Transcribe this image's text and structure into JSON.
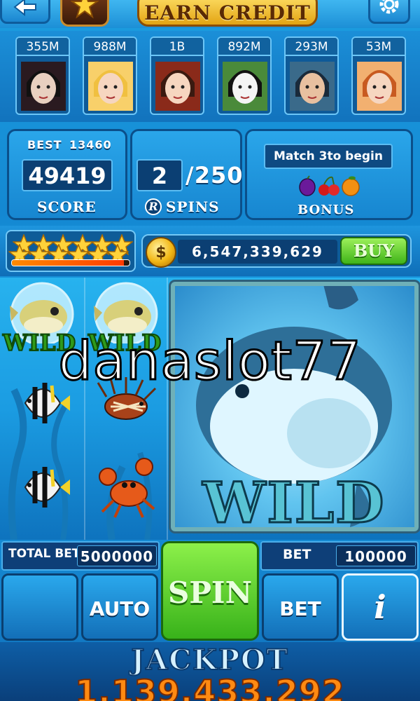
{
  "header": {
    "earn_credit_label": "EARN CREDIT",
    "back_icon": "back-arrow-icon",
    "rank_icon": "star-badge-icon",
    "settings_icon": "gear-icon"
  },
  "players": [
    {
      "amount": "355M",
      "avatar": "vampire-avatar",
      "color": "#7a2a2a"
    },
    {
      "amount": "988M",
      "avatar": "blonde-woman-avatar",
      "color": "#e8b84a"
    },
    {
      "amount": "1B",
      "avatar": "princess-avatar",
      "color": "#c0402a"
    },
    {
      "amount": "892M",
      "avatar": "panda-avatar",
      "color": "#e0e0e0"
    },
    {
      "amount": "293M",
      "avatar": "cap-boy-avatar",
      "color": "#2a4a6a"
    },
    {
      "amount": "53M",
      "avatar": "redhead-woman-avatar",
      "color": "#d86a3a"
    }
  ],
  "score_panel": {
    "best_label": "BEST",
    "best_value": "13460",
    "score_value": "49419",
    "score_label": "SCORE"
  },
  "spins_panel": {
    "current": "2",
    "total": "/250",
    "label": "SPINS",
    "logo_letter": "R"
  },
  "bonus_panel": {
    "match_text": "Match 3to begin",
    "label": "BONUS",
    "fruits": [
      "plum-icon",
      "cherry-icon",
      "orange-icon"
    ]
  },
  "level": {
    "stars": 6,
    "xp_fraction": 0.95
  },
  "credits": {
    "coin_symbol": "$",
    "value": "6,547,339,629",
    "buy_label": "BUY"
  },
  "reels": {
    "small_wild_label": "WILD",
    "big_wild_label": "WILD",
    "symbols": [
      "pufferfish-wild",
      "pufferfish-wild",
      "angelfish",
      "lionfish",
      "angelfish",
      "crab"
    ]
  },
  "watermark": "danaslot77",
  "controls": {
    "total_bet_label": "TOTAL BET",
    "total_bet_value": "5000000",
    "bet_label": "BET",
    "bet_value": "100000",
    "spin_label": "SPIN",
    "auto_label": "AUTO",
    "bet_button_label": "BET",
    "info_label": "i"
  },
  "jackpot": {
    "title": "JACKPOT",
    "value": "1,139,433,292"
  }
}
